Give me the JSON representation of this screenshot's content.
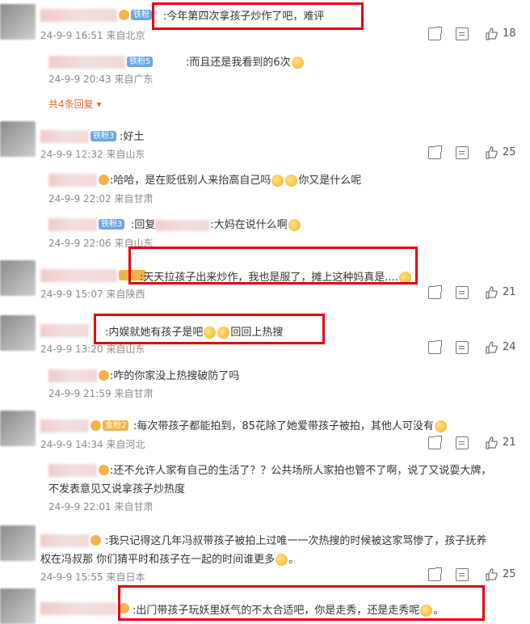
{
  "comments": [
    {
      "badge": "铁粉",
      "text": ":今年第四次拿孩子炒作了吧，难评",
      "time": "24-9-9 16:51",
      "loc": "来自北京",
      "likes": "18"
    },
    {
      "badge": "铁粉5",
      "text": ":而且还是我看到的6次",
      "time": "24-9-9 20:43",
      "loc": "来自广东",
      "more": "共4条回复"
    },
    {
      "badge": "铁粉3",
      "text": ":好土",
      "time": "24-9-9 12:32",
      "loc": "来自山东",
      "likes": "25"
    },
    {
      "text": ":哈哈，是在贬低别人来抬高自己吗",
      "text2": "你又是什么呢",
      "time": "24-9-9 22:02",
      "loc": "来自甘肃"
    },
    {
      "badge": "铁粉3",
      "prefix": ":回复",
      "text": ":大妈在说什么啊",
      "time": "24-9-9 22:06",
      "loc": "来自山东"
    },
    {
      "text": ":天天拉孩子出来炒作，我也是服了，摊上这种妈真是....",
      "time": "24-9-9 15:07",
      "loc": "来自陕西",
      "likes": "21"
    },
    {
      "text": ":内娱就她有孩子是吧",
      "text2": "回回上热搜",
      "time": "24-9-9 13:20",
      "loc": "来自山东",
      "likes": "24"
    },
    {
      "text": ":咋的你家没上热搜破防了吗",
      "time": "24-9-9 21:59",
      "loc": "来自甘肃"
    },
    {
      "badge": "金粉2",
      "text": ":每次带孩子都能拍到，85花除了她爱带孩子被拍，其他人可没有",
      "time": "24-9-9 14:34",
      "loc": "来自河北",
      "likes": "21"
    },
    {
      "text": ":还不允许人家有自己的生活了？？公共场所人家拍也管不了啊，说了又说耍大牌，",
      "text_l2": "不发表意见又说拿孩子炒热度",
      "time": "24-9-9 22:01",
      "loc": "来自甘肃"
    },
    {
      "text": ":我只记得这几年冯叔带孩子被拍上过唯一一次热搜的时候被这家骂惨了，孩子抚养",
      "text_l2": "权在冯叔那 你们猜平时和孩子在一起的时间谁更多",
      "time": "24-9-9 15:55",
      "loc": "来自日本",
      "likes": "25"
    },
    {
      "text": ":出门带孩子玩妖里妖气的不太合适吧，你是走秀，还是走秀呢",
      "time": "",
      "loc": ""
    }
  ]
}
